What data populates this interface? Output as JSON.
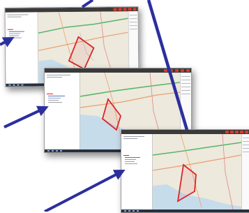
{
  "colors": {
    "arrow": "#2b2f9e",
    "polygon": "#d8262a",
    "water": "#c7dcea",
    "land": "#ede9dc",
    "road_major": "#e8a070",
    "road_green": "#59b36b"
  },
  "screens": [
    {
      "id": "screen-1",
      "sidebar_lines": 6,
      "icons": [
        "close-icon",
        "layers-icon",
        "grid-icon",
        "info-icon",
        "menu-icon"
      ]
    },
    {
      "id": "screen-2",
      "sidebar_lines": 6,
      "icons": [
        "close-icon",
        "layers-icon",
        "grid-icon",
        "info-icon",
        "menu-icon"
      ]
    },
    {
      "id": "screen-3",
      "sidebar_lines": 6,
      "icons": [
        "close-icon",
        "layers-icon",
        "grid-icon",
        "info-icon",
        "menu-icon"
      ]
    }
  ],
  "arrows": [
    "arrow-top-left",
    "arrow-top-right",
    "arrow-middle-left",
    "arrow-long-diagonal",
    "arrow-bottom-left"
  ]
}
